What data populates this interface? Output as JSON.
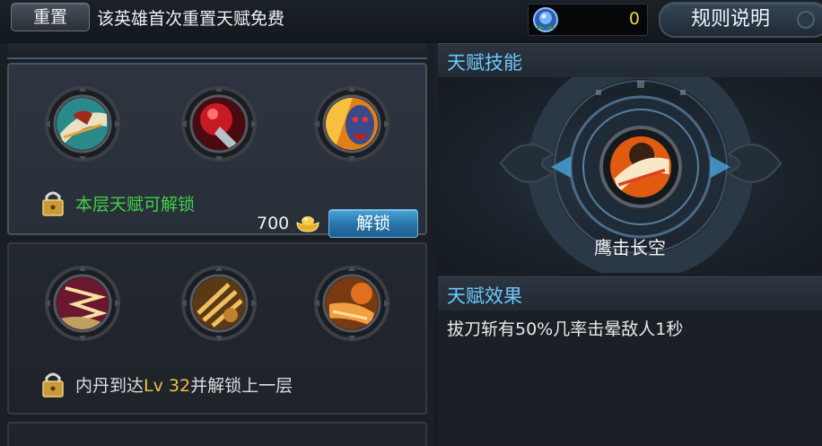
{
  "topbar": {
    "reset_label": "重置",
    "reset_note": "该英雄首次重置天赋免费",
    "currency_icon": "blue-crystal-icon",
    "currency_value": "0",
    "rules_label": "规则说明"
  },
  "tiers": [
    {
      "state": "unlockable",
      "skills": [
        "blade-slash-skill-icon",
        "crimson-gauntlet-skill-icon",
        "demon-face-skill-icon"
      ],
      "status_text": "本层天赋可解锁",
      "cost": "700",
      "cost_icon": "gold-ingot-icon",
      "unlock_label": "解锁"
    },
    {
      "state": "locked",
      "skills": [
        "lightning-strike-skill-icon",
        "golden-claw-skill-icon",
        "fire-fist-skill-icon"
      ],
      "condition_prefix": "内丹到达",
      "condition_level": "Lv 32",
      "condition_suffix": "并解锁上一层"
    }
  ],
  "detail": {
    "skill_header": "天赋技能",
    "selected_skill_name": "鹰击长空",
    "effect_header": "天赋效果",
    "effect_text": "拔刀斩有50%几率击晕敌人1秒"
  },
  "colors": {
    "accent_blue": "#6cc8ff",
    "unlock_green": "#3fd14a",
    "gold": "#f0c13a"
  }
}
